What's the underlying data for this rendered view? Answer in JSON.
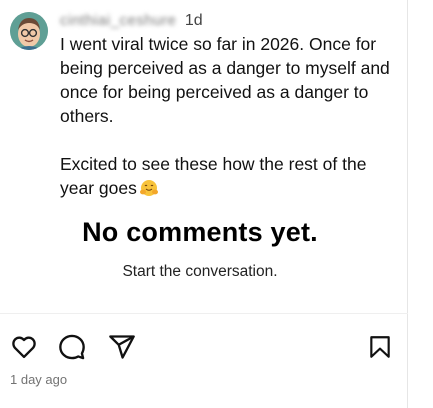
{
  "post": {
    "username": "cinthiai_ceshure",
    "time_ago": "1d",
    "caption_para1": "I went viral twice so far in 2026. Once for being perceived as a danger to myself and once for being perceived as a danger to others.",
    "caption_para2": "Excited to see these how the rest of the year goes",
    "emoji": "hugging-face-emoji"
  },
  "comments": {
    "empty_title": "No comments yet.",
    "empty_subtitle": "Start the conversation."
  },
  "actions": {
    "like_icon": "heart-outline-icon",
    "comment_icon": "speech-bubble-icon",
    "share_icon": "paper-plane-icon",
    "save_icon": "bookmark-outline-icon"
  },
  "footer": {
    "date": "1 day ago"
  }
}
